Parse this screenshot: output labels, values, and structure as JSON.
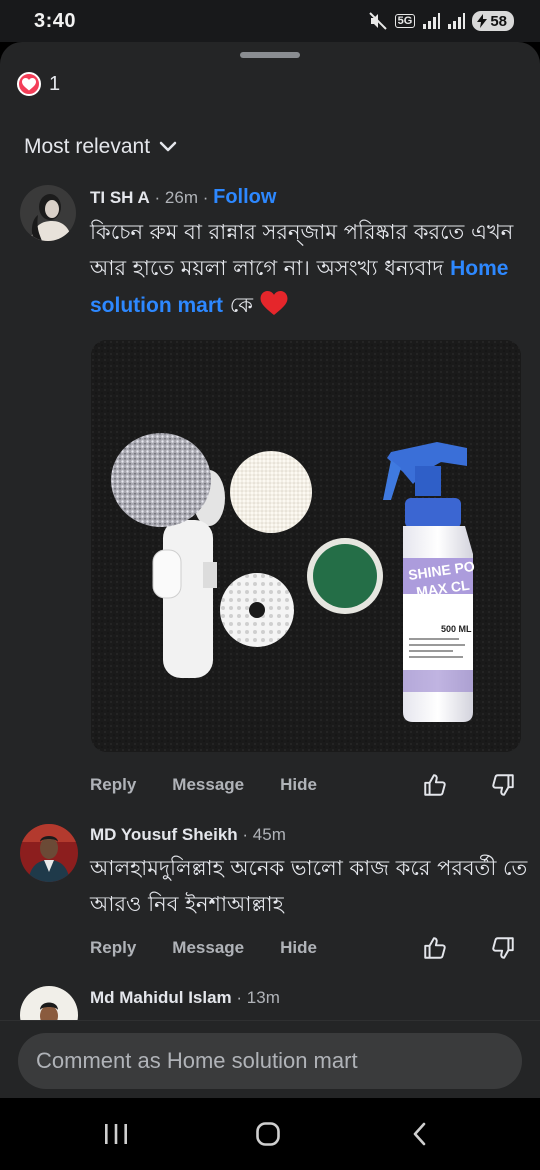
{
  "status_bar": {
    "time": "3:40",
    "network": "5G",
    "battery": "58"
  },
  "reactions": {
    "icon": "heart-icon",
    "count": "1"
  },
  "sort": {
    "label": "Most relevant",
    "icon": "chevron-down-icon"
  },
  "comments": [
    {
      "author": "TI SH A",
      "time": " · 26m · ",
      "follow_label": "Follow",
      "text_before": "কিচেন রুম বা রান্নার সরন্জাম পরিষ্কার করতে এখন আর হাতে ময়লা লাগে না। অসংখ্য ধন্যবাদ ",
      "mention": "Home solution mart",
      "text_after": " কে",
      "emoji": "red-heart-icon",
      "photo": {
        "bottle_label_line1": "SHINE PO",
        "bottle_label_line2": "MAX CL",
        "bottle_volume": "500 ML"
      },
      "actions": {
        "reply": "Reply",
        "message": "Message",
        "hide": "Hide"
      }
    },
    {
      "author": "MD Yousuf Sheikh",
      "time": " · 45m",
      "text": "আলহামদুলিল্লাহ অনেক ভালো কাজ করে পরবর্তী তে আরও নিব ইনশাআল্লাহ",
      "actions": {
        "reply": "Reply",
        "message": "Message",
        "hide": "Hide"
      }
    },
    {
      "author": "Md Mahidul Islam",
      "time": " · 13m"
    }
  ],
  "comment_bar": {
    "placeholder": "Comment as Home solution mart"
  },
  "colors": {
    "background": "#242526",
    "text": "#e4e6eb",
    "secondary_text": "#b0b3b8",
    "link": "#2d88ff",
    "heart": "#f33e58"
  }
}
